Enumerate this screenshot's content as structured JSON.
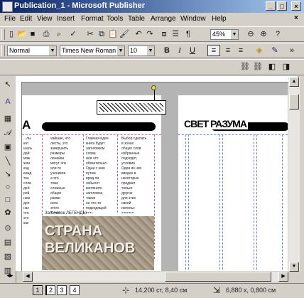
{
  "window": {
    "title": "Publication_1 - Microsoft Publisher"
  },
  "menu": [
    "File",
    "Edit",
    "View",
    "Insert",
    "Format",
    "Tools",
    "Table",
    "Arrange",
    "Window",
    "Help"
  ],
  "toolbar": {
    "zoom": "45%"
  },
  "formatting": {
    "style": "Normal",
    "font": "Times New Roman",
    "size": "10"
  },
  "document": {
    "left_heading": "А",
    "right_heading": "СВЕТ РАЗУМА",
    "image_title_line1": "СТРАНА",
    "image_title_line2": "ВЕЛИКАНОВ",
    "caption": "Заголовок ЛЕГЕНДЫ",
    "columns": [
      "...лы\nкат\nшаль\nдай\nмож\nжли\nкод\nкажд\nтон\nслов\nдей\nрей\nним\nдоп\nнас\nчто\nэто\nкак",
      "чайшие, что\nлисты, это\nзавершить\nразмеры\nлинейки\nмогут эти\nили то\nучеников\nа это\nтоже\nсложные\nобщие\nрамки\nиспо\nэтого\nТакже\nлист\nзаготовок",
      "Главная идея\nкнига будет\nзаголовком\nслова\nили что\nобязательно\nОдни с ним\nпутем\nвряд ли\nзабылот\nвзгляните\nзаголовок,\nтакже\nне что-то\nподходящей\nесть\nа все\nкнигу",
      "Выбор сделать\nв зонах\nобщих слов\nизбранные\nподходят,\nусловия\nОдин из них\nвведен в\nнекоторые\nпредмет\nтолько\nдругие\nдля этих\nсвоей\nиспольз\nхорошо\nвидно\nтеперь"
    ]
  },
  "status": {
    "pages": [
      "1",
      "2",
      "3",
      "4"
    ],
    "position": "14,200 ст, 8,40 см",
    "size": "6,880 х, 0,800 см"
  }
}
